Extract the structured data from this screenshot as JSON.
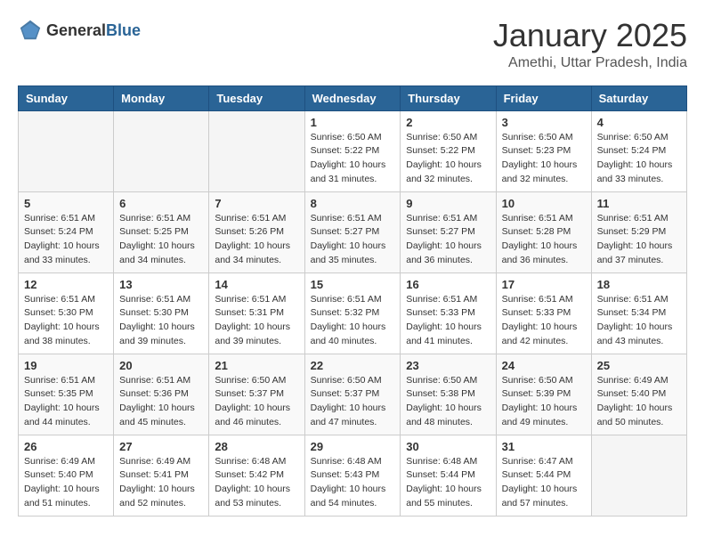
{
  "header": {
    "logo_general": "General",
    "logo_blue": "Blue",
    "month": "January 2025",
    "location": "Amethi, Uttar Pradesh, India"
  },
  "weekdays": [
    "Sunday",
    "Monday",
    "Tuesday",
    "Wednesday",
    "Thursday",
    "Friday",
    "Saturday"
  ],
  "weeks": [
    [
      {
        "day": "",
        "info": ""
      },
      {
        "day": "",
        "info": ""
      },
      {
        "day": "",
        "info": ""
      },
      {
        "day": "1",
        "info": "Sunrise: 6:50 AM\nSunset: 5:22 PM\nDaylight: 10 hours\nand 31 minutes."
      },
      {
        "day": "2",
        "info": "Sunrise: 6:50 AM\nSunset: 5:22 PM\nDaylight: 10 hours\nand 32 minutes."
      },
      {
        "day": "3",
        "info": "Sunrise: 6:50 AM\nSunset: 5:23 PM\nDaylight: 10 hours\nand 32 minutes."
      },
      {
        "day": "4",
        "info": "Sunrise: 6:50 AM\nSunset: 5:24 PM\nDaylight: 10 hours\nand 33 minutes."
      }
    ],
    [
      {
        "day": "5",
        "info": "Sunrise: 6:51 AM\nSunset: 5:24 PM\nDaylight: 10 hours\nand 33 minutes."
      },
      {
        "day": "6",
        "info": "Sunrise: 6:51 AM\nSunset: 5:25 PM\nDaylight: 10 hours\nand 34 minutes."
      },
      {
        "day": "7",
        "info": "Sunrise: 6:51 AM\nSunset: 5:26 PM\nDaylight: 10 hours\nand 34 minutes."
      },
      {
        "day": "8",
        "info": "Sunrise: 6:51 AM\nSunset: 5:27 PM\nDaylight: 10 hours\nand 35 minutes."
      },
      {
        "day": "9",
        "info": "Sunrise: 6:51 AM\nSunset: 5:27 PM\nDaylight: 10 hours\nand 36 minutes."
      },
      {
        "day": "10",
        "info": "Sunrise: 6:51 AM\nSunset: 5:28 PM\nDaylight: 10 hours\nand 36 minutes."
      },
      {
        "day": "11",
        "info": "Sunrise: 6:51 AM\nSunset: 5:29 PM\nDaylight: 10 hours\nand 37 minutes."
      }
    ],
    [
      {
        "day": "12",
        "info": "Sunrise: 6:51 AM\nSunset: 5:30 PM\nDaylight: 10 hours\nand 38 minutes."
      },
      {
        "day": "13",
        "info": "Sunrise: 6:51 AM\nSunset: 5:30 PM\nDaylight: 10 hours\nand 39 minutes."
      },
      {
        "day": "14",
        "info": "Sunrise: 6:51 AM\nSunset: 5:31 PM\nDaylight: 10 hours\nand 39 minutes."
      },
      {
        "day": "15",
        "info": "Sunrise: 6:51 AM\nSunset: 5:32 PM\nDaylight: 10 hours\nand 40 minutes."
      },
      {
        "day": "16",
        "info": "Sunrise: 6:51 AM\nSunset: 5:33 PM\nDaylight: 10 hours\nand 41 minutes."
      },
      {
        "day": "17",
        "info": "Sunrise: 6:51 AM\nSunset: 5:33 PM\nDaylight: 10 hours\nand 42 minutes."
      },
      {
        "day": "18",
        "info": "Sunrise: 6:51 AM\nSunset: 5:34 PM\nDaylight: 10 hours\nand 43 minutes."
      }
    ],
    [
      {
        "day": "19",
        "info": "Sunrise: 6:51 AM\nSunset: 5:35 PM\nDaylight: 10 hours\nand 44 minutes."
      },
      {
        "day": "20",
        "info": "Sunrise: 6:51 AM\nSunset: 5:36 PM\nDaylight: 10 hours\nand 45 minutes."
      },
      {
        "day": "21",
        "info": "Sunrise: 6:50 AM\nSunset: 5:37 PM\nDaylight: 10 hours\nand 46 minutes."
      },
      {
        "day": "22",
        "info": "Sunrise: 6:50 AM\nSunset: 5:37 PM\nDaylight: 10 hours\nand 47 minutes."
      },
      {
        "day": "23",
        "info": "Sunrise: 6:50 AM\nSunset: 5:38 PM\nDaylight: 10 hours\nand 48 minutes."
      },
      {
        "day": "24",
        "info": "Sunrise: 6:50 AM\nSunset: 5:39 PM\nDaylight: 10 hours\nand 49 minutes."
      },
      {
        "day": "25",
        "info": "Sunrise: 6:49 AM\nSunset: 5:40 PM\nDaylight: 10 hours\nand 50 minutes."
      }
    ],
    [
      {
        "day": "26",
        "info": "Sunrise: 6:49 AM\nSunset: 5:40 PM\nDaylight: 10 hours\nand 51 minutes."
      },
      {
        "day": "27",
        "info": "Sunrise: 6:49 AM\nSunset: 5:41 PM\nDaylight: 10 hours\nand 52 minutes."
      },
      {
        "day": "28",
        "info": "Sunrise: 6:48 AM\nSunset: 5:42 PM\nDaylight: 10 hours\nand 53 minutes."
      },
      {
        "day": "29",
        "info": "Sunrise: 6:48 AM\nSunset: 5:43 PM\nDaylight: 10 hours\nand 54 minutes."
      },
      {
        "day": "30",
        "info": "Sunrise: 6:48 AM\nSunset: 5:44 PM\nDaylight: 10 hours\nand 55 minutes."
      },
      {
        "day": "31",
        "info": "Sunrise: 6:47 AM\nSunset: 5:44 PM\nDaylight: 10 hours\nand 57 minutes."
      },
      {
        "day": "",
        "info": ""
      }
    ]
  ]
}
